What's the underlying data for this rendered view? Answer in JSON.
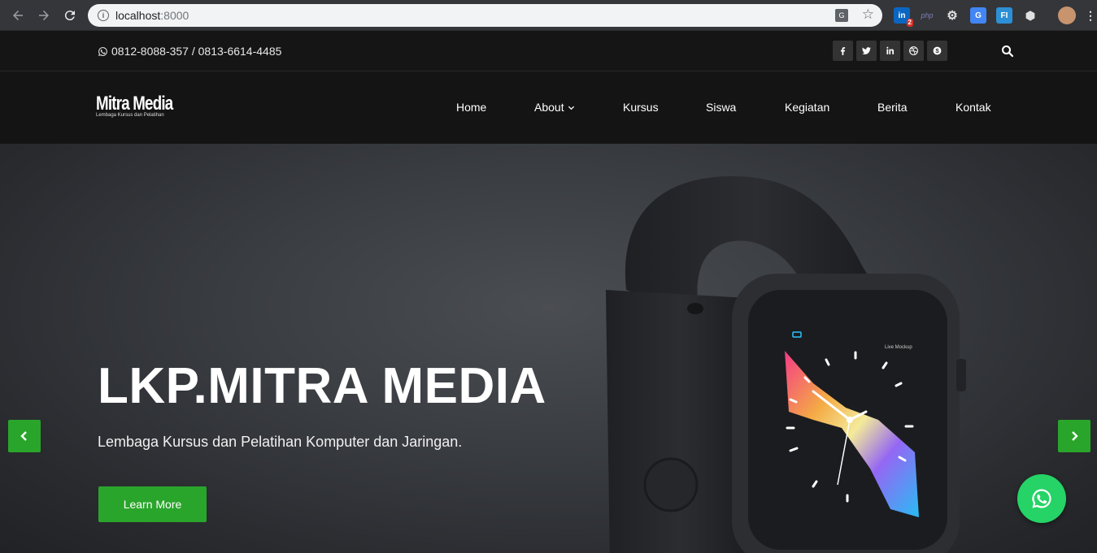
{
  "browser": {
    "url_host": "localhost",
    "url_port": ":8000",
    "extensions": [
      {
        "name": "linkedin-ext-icon",
        "label": "in",
        "badge": "2",
        "color": "#0a66c2"
      },
      {
        "name": "php-ext-icon",
        "label": "php",
        "color": "#35363a"
      },
      {
        "name": "gear-ext-icon",
        "label": "⚙",
        "color": "#35363a"
      },
      {
        "name": "translate-ext-icon",
        "label": "G",
        "color": "#4285f4"
      },
      {
        "name": "fi-ext-icon",
        "label": "FI",
        "color": "#2d8fd5"
      },
      {
        "name": "cube-ext-icon",
        "label": "⬢",
        "color": "#35363a"
      }
    ]
  },
  "topbar": {
    "phone": "0812-8088-357 / 0813-6614-4485"
  },
  "header": {
    "logo_main": "Mitra Media",
    "logo_sub": "Lembaga Kursus dan Pelatihan",
    "menu": [
      "Home",
      "About",
      "Kursus",
      "Siswa",
      "Kegiatan",
      "Berita",
      "Kontak"
    ]
  },
  "hero": {
    "title": "LKP.MITRA MEDIA",
    "subtitle": "Lembaga Kursus dan Pelatihan Komputer dan Jaringan.",
    "button": "Learn More",
    "watch_label": "Live Mockup"
  },
  "colors": {
    "accent": "#2aa52b",
    "whatsapp": "#25d366"
  }
}
